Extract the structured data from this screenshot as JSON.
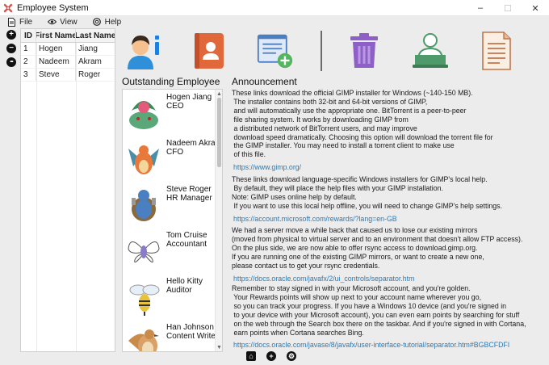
{
  "window": {
    "title": "Employee System",
    "minimize": "–",
    "maximize": "☐",
    "close": "✕"
  },
  "menu": [
    {
      "label": "File",
      "icon": "file-icon"
    },
    {
      "label": "View",
      "icon": "eye-icon"
    },
    {
      "label": "Help",
      "icon": "help-icon"
    }
  ],
  "side_tools": [
    {
      "icon": "add-icon",
      "glyph": "+"
    },
    {
      "icon": "remove-icon",
      "glyph": "−"
    },
    {
      "icon": "more-icon",
      "glyph": "•••"
    }
  ],
  "table": {
    "columns": [
      "ID",
      "First Name",
      "Last Name"
    ],
    "rows": [
      {
        "id": "1",
        "first": "Hogen",
        "last": "Jiang"
      },
      {
        "id": "2",
        "first": "Nadeem",
        "last": "Akram"
      },
      {
        "id": "3",
        "first": "Steve",
        "last": "Roger"
      }
    ]
  },
  "toolbar": [
    {
      "icon": "user-info-icon"
    },
    {
      "icon": "contact-book-icon"
    },
    {
      "icon": "add-note-icon"
    },
    {
      "icon": "trash-icon"
    },
    {
      "icon": "user-laptop-icon"
    },
    {
      "icon": "document-icon"
    }
  ],
  "outstanding": {
    "title": "Outstanding Employee",
    "employees": [
      {
        "name": "Hogen Jiang",
        "role": "CEO",
        "avatar": "venusaur-icon",
        "color": "#5aa87a"
      },
      {
        "name": "Nadeem Akram",
        "role": "CFO",
        "avatar": "charizard-icon",
        "color": "#e8793a"
      },
      {
        "name": "Steve Roger",
        "role": "HR Manager",
        "avatar": "blastoise-icon",
        "color": "#4a7fc1"
      },
      {
        "name": "Tom Cruise",
        "role": "Accountant",
        "avatar": "butterfree-icon",
        "color": "#8a7ac8"
      },
      {
        "name": "Hello Kitty",
        "role": "Auditor",
        "avatar": "beedrill-icon",
        "color": "#e8c23a"
      },
      {
        "name": "Han Johnson",
        "role": "Content Writer",
        "avatar": "pidgeotto-icon",
        "color": "#c98a4a"
      }
    ]
  },
  "announcement": {
    "title": "Announcement",
    "paragraphs": [
      {
        "lines": [
          "These links download the official GIMP installer for Windows (~140-150 MB).",
          " The installer contains both 32-bit and 64-bit versions of GIMP,",
          " and will automatically use the appropriate one. BitTorrent is a peer-to-peer",
          " file sharing system. It works by downloading GIMP from",
          " a distributed network of BitTorrent users, and may improve",
          " download speed dramatically. Choosing this option will download the torrent file for",
          " the GIMP installer. You may need to install a torrent client to make use",
          " of this file."
        ],
        "link": "https://www.gimp.org/"
      },
      {
        "lines": [
          "These links download language-specific Windows installers for GIMP's local help.",
          " By default, they will place the help files with your GIMP installation.",
          "Note: GIMP uses online help by default.",
          " If you want to use this local help offline, you will need to change GIMP's help settings."
        ],
        "link": "https://account.microsoft.com/rewards/?lang=en-GB"
      },
      {
        "lines": [
          "We had a server move a while back that caused us to lose our existing mirrors",
          "(moved from physical to virtual server and to an environment that doesn't allow FTP access).",
          "On the plus side, we are now able to offer rsync access to download.gimp.org.",
          "If you are running one of the existing GIMP mirrors, or want to create a new one,",
          "please contact us to get your rsync credentials."
        ],
        "link": "https://docs.oracle.com/javafx/2/ui_controls/separator.htm"
      },
      {
        "lines": [
          "Remember to stay signed in with your Microsoft account, and you're golden.",
          " Your Rewards points will show up next to your account name wherever you go,",
          " so you can track your progress. If you have a Windows 10 device (and you're signed in",
          " to your device with your Microsoft account), you can even earn points by searching for stuff",
          " on the web through the Search box there on the taskbar. And if you're signed in with Cortana,",
          " earn points when Cortana searches Bing."
        ],
        "link": "https://docs.oracle.com/javase/8/javafx/user-interface-tutorial/separator.htm#BGBCFDFI"
      }
    ]
  },
  "bottom_tools": [
    {
      "icon": "home-icon",
      "glyph": "⌂"
    },
    {
      "icon": "add-icon",
      "glyph": "+"
    },
    {
      "icon": "settings-icon",
      "glyph": "⚙"
    }
  ]
}
